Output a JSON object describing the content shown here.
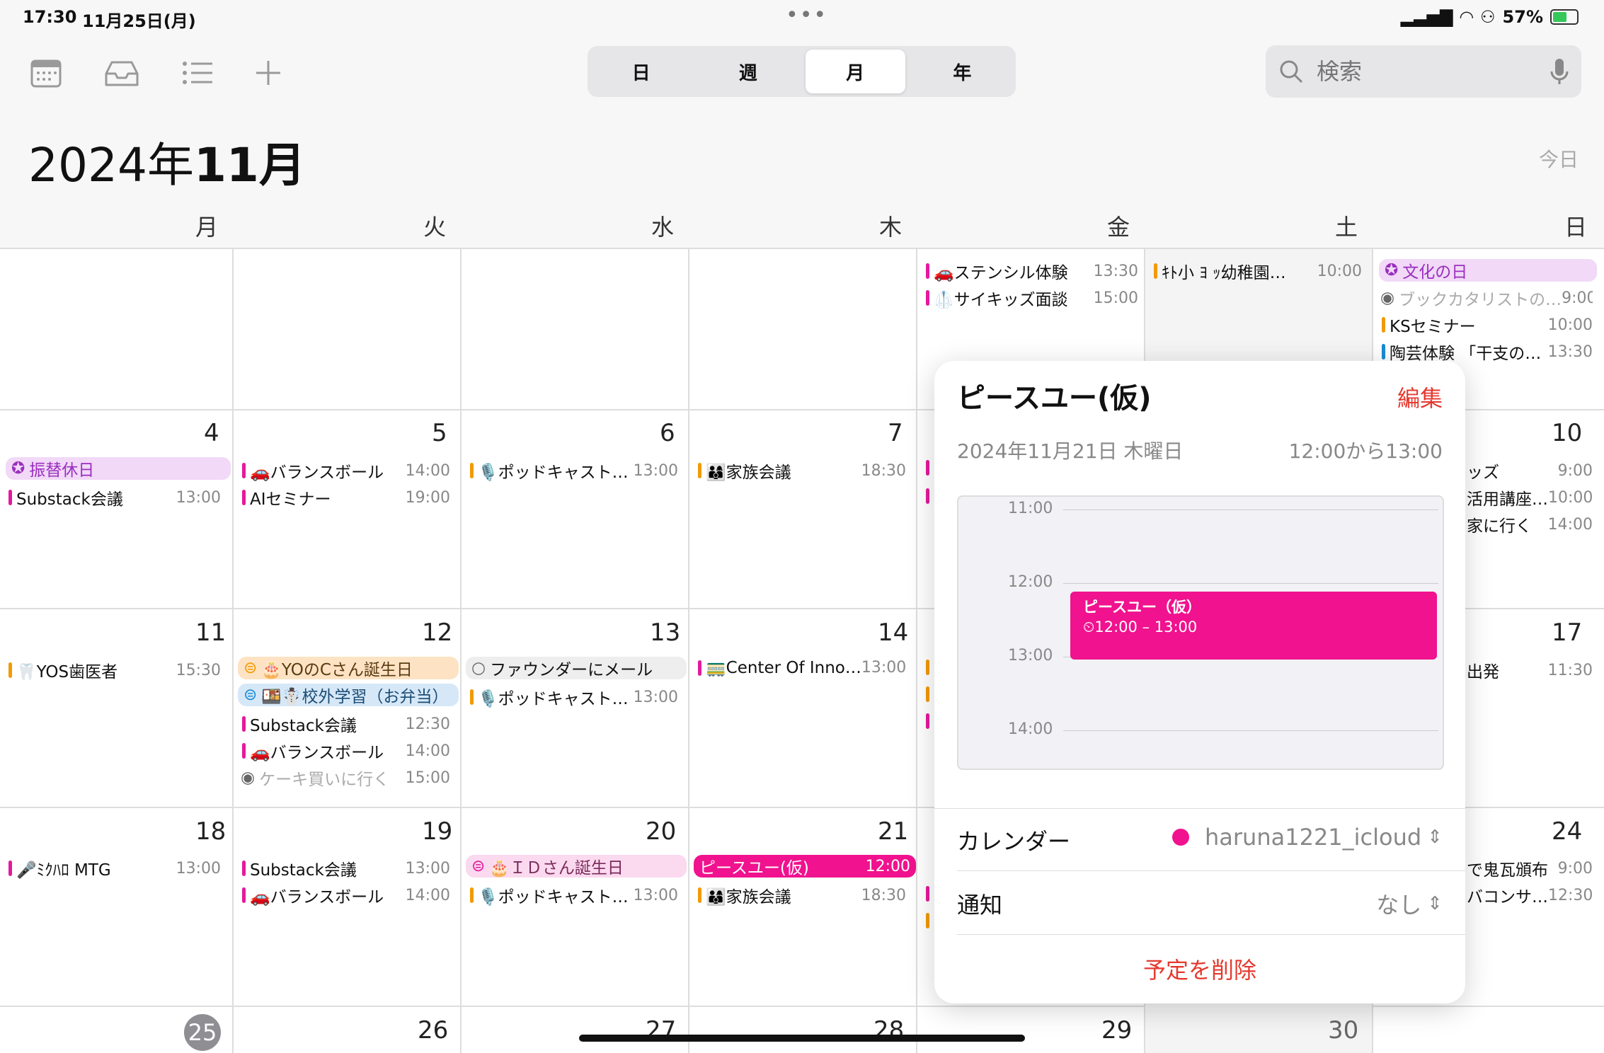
{
  "status": {
    "time": "17:30",
    "date": "11月25日(月)",
    "battery": "57%"
  },
  "toolbar": {
    "segments": [
      "日",
      "週",
      "月",
      "年"
    ],
    "selected": 2,
    "search_placeholder": "検索"
  },
  "header": {
    "year": "2024年",
    "month": "11月",
    "today": "今日"
  },
  "weekdays": [
    "月",
    "火",
    "水",
    "木",
    "金",
    "土",
    "日"
  ],
  "row0": {
    "fri": [
      {
        "text": "🚗ステンシル体験",
        "time": "13:30",
        "color": "#e5199c"
      },
      {
        "text": "🥼サイキッズ面談",
        "time": "15:00",
        "color": "#e5199c"
      }
    ],
    "sat": [
      {
        "text": "ｷﾄ小 ﾖ ｯ幼稚園…",
        "time": "10:00",
        "color": "#f29a00"
      }
    ],
    "sun": [
      {
        "text": "文化の日",
        "time": "",
        "color": "#b04bd6"
      },
      {
        "text": "ブックカタリストの…",
        "time": "9:00",
        "color": "#777"
      },
      {
        "text": "KSセミナー",
        "time": "10:00",
        "color": "#f29a00"
      },
      {
        "text": "陶芸体験 「干支の…",
        "time": "13:30",
        "color": "#1a8ad6"
      }
    ]
  },
  "row1": {
    "days": [
      "4",
      "5",
      "6",
      "7",
      "10"
    ],
    "mon": [
      {
        "text": "振替休日",
        "time": "",
        "color": "#b04bd6"
      },
      {
        "text": "Substack会議",
        "time": "13:00",
        "color": "#e5199c"
      }
    ],
    "tue": [
      {
        "text": "🚗バランスボール",
        "time": "14:00",
        "color": "#e5199c"
      },
      {
        "text": "AIセミナー",
        "time": "19:00",
        "color": "#e5199c"
      }
    ],
    "wed": [
      {
        "text": "🎙️ポッドキャスト…",
        "time": "13:00",
        "color": "#f29a00"
      }
    ],
    "thu": [
      {
        "text": "👨‍👩‍👦家族会議",
        "time": "18:30",
        "color": "#f29a00"
      }
    ],
    "sun": [
      {
        "text": "ッズ",
        "time": "9:00"
      },
      {
        "text": "活用講座…",
        "time": "10:00"
      },
      {
        "text": "家に行く",
        "time": "14:00"
      }
    ]
  },
  "row2": {
    "days": [
      "11",
      "12",
      "13",
      "14",
      "17"
    ],
    "mon": [
      {
        "text": "🦷YOS歯医者",
        "time": "15:30",
        "color": "#f29a00"
      }
    ],
    "tue": [
      {
        "text": "🎂YOのCさん誕生日",
        "time": "",
        "color": "#f29a00"
      },
      {
        "text": "🍱☃️校外学習（お弁当）",
        "time": "",
        "color": "#1a8ad6"
      },
      {
        "text": "Substack会議",
        "time": "12:30",
        "color": "#e5199c"
      },
      {
        "text": "🚗バランスボール",
        "time": "14:00",
        "color": "#e5199c"
      },
      {
        "text": "ケーキ買いに行く",
        "time": "15:00",
        "color": "#777"
      }
    ],
    "wed": [
      {
        "text": "ファウンダーにメール",
        "time": "",
        "color": "#777"
      },
      {
        "text": "🎙️ポッドキャスト…",
        "time": "13:00",
        "color": "#f29a00"
      }
    ],
    "thu": [
      {
        "text": "🚃Center Of Inno…",
        "time": "13:00",
        "color": "#e5199c"
      }
    ],
    "sun": [
      {
        "text": "出発",
        "time": "11:30"
      }
    ]
  },
  "row3": {
    "days": [
      "18",
      "19",
      "20",
      "21",
      "24"
    ],
    "mon": [
      {
        "text": "🎤ﾐｸﾊﾛ MTG",
        "time": "13:00",
        "color": "#e5199c"
      }
    ],
    "tue": [
      {
        "text": "Substack会議",
        "time": "13:00",
        "color": "#e5199c"
      },
      {
        "text": "🚗バランスボール",
        "time": "14:00",
        "color": "#e5199c"
      }
    ],
    "wed": [
      {
        "text": "🎂ＩＤさん誕生日",
        "time": "",
        "color": "#e5199c"
      },
      {
        "text": "🎙️ポッドキャスト…",
        "time": "13:00",
        "color": "#f29a00"
      }
    ],
    "thu": [
      {
        "text": "ピースユー(仮)",
        "time": "12:00",
        "color": "#f0128e"
      },
      {
        "text": "👨‍👩‍👦家族会議",
        "time": "18:30",
        "color": "#f29a00"
      }
    ],
    "sun": [
      {
        "text": "で鬼瓦頒布",
        "time": "9:00"
      },
      {
        "text": "バコンサ…",
        "time": "12:30"
      }
    ]
  },
  "row4": {
    "days": [
      "25",
      "26",
      "27",
      "28",
      "29",
      "30"
    ]
  },
  "popover": {
    "title": "ピースユー(仮)",
    "edit": "編集",
    "date": "2024年11月21日 木曜日",
    "range": "12:00から13:00",
    "hours": [
      "11:00",
      "12:00",
      "13:00",
      "14:00"
    ],
    "block_title": "ピースユー（仮）",
    "block_time": "⏲12:00 – 13:00",
    "calendar_label": "カレンダー",
    "calendar_value": "haruna1221_icloud",
    "alert_label": "通知",
    "alert_value": "なし",
    "delete": "予定を削除",
    "color": "#f0128e"
  }
}
